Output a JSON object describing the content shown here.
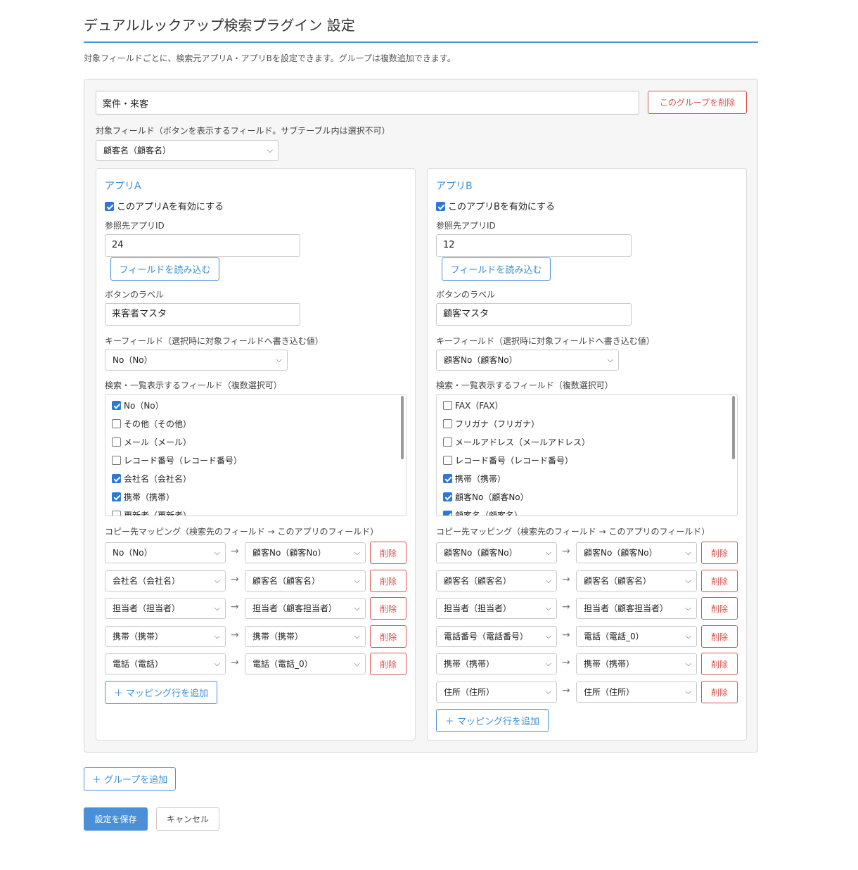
{
  "page": {
    "title": "デュアルルックアップ検索プラグイン 設定",
    "description": "対象フィールドごとに、検索元アプリA・アプリBを設定できます。グループは複数追加できます。"
  },
  "group": {
    "name": "案件・来客",
    "delete_label": "このグループを削除",
    "target_label": "対象フィールド（ボタンを表示するフィールド。サブテーブル内は選択不可）",
    "target_value": "顧客名（顧客名）"
  },
  "app_a": {
    "title": "アプリA",
    "enable_label": "このアプリAを有効にする",
    "enabled": true,
    "app_id_label": "参照先アプリID",
    "app_id": "24",
    "load_label": "フィールドを読み込む",
    "button_label_label": "ボタンのラベル",
    "button_label": "来客者マスタ",
    "key_field_label": "キーフィールド（選択時に対象フィールドへ書き込む値）",
    "key_field": "No（No）",
    "fields_label": "検索・一覧表示するフィールド（複数選択可）",
    "fields": [
      {
        "label": "No（No）",
        "checked": true
      },
      {
        "label": "その他（その他）",
        "checked": false
      },
      {
        "label": "メール（メール）",
        "checked": false
      },
      {
        "label": "レコード番号（レコード番号）",
        "checked": false
      },
      {
        "label": "会社名（会社名）",
        "checked": true
      },
      {
        "label": "携帯（携帯）",
        "checked": true
      },
      {
        "label": "更新者（更新者）",
        "checked": false
      }
    ],
    "mapping_label": "コピー先マッピング（検索先のフィールド → このアプリのフィールド）",
    "mappings": [
      {
        "from": "No（No）",
        "to": "顧客No（顧客No）",
        "delete": "削除"
      },
      {
        "from": "会社名（会社名）",
        "to": "顧客名（顧客名）",
        "delete": "削除"
      },
      {
        "from": "担当者（担当者）",
        "to": "担当者（顧客担当者）",
        "delete": "削除"
      },
      {
        "from": "携帯（携帯）",
        "to": "携帯（携帯）",
        "delete": "削除"
      },
      {
        "from": "電話（電話）",
        "to": "電話（電話_0）",
        "delete": "削除"
      }
    ],
    "add_mapping_label": "＋ マッピング行を追加"
  },
  "app_b": {
    "title": "アプリB",
    "enable_label": "このアプリBを有効にする",
    "enabled": true,
    "app_id_label": "参照先アプリID",
    "app_id": "12",
    "load_label": "フィールドを読み込む",
    "button_label_label": "ボタンのラベル",
    "button_label": "顧客マスタ",
    "key_field_label": "キーフィールド（選択時に対象フィールドへ書き込む値）",
    "key_field": "顧客No（顧客No）",
    "fields_label": "検索・一覧表示するフィールド（複数選択可）",
    "fields": [
      {
        "label": "FAX（FAX）",
        "checked": false
      },
      {
        "label": "フリガナ（フリガナ）",
        "checked": false
      },
      {
        "label": "メールアドレス（メールアドレス）",
        "checked": false
      },
      {
        "label": "レコード番号（レコード番号）",
        "checked": false
      },
      {
        "label": "携帯（携帯）",
        "checked": true
      },
      {
        "label": "顧客No（顧客No）",
        "checked": true
      },
      {
        "label": "顧客名（顧客名）",
        "checked": true
      }
    ],
    "mapping_label": "コピー先マッピング（検索先のフィールド → このアプリのフィールド）",
    "mappings": [
      {
        "from": "顧客No（顧客No）",
        "to": "顧客No（顧客No）",
        "delete": "削除"
      },
      {
        "from": "顧客名（顧客名）",
        "to": "顧客名（顧客名）",
        "delete": "削除"
      },
      {
        "from": "担当者（担当者）",
        "to": "担当者（顧客担当者）",
        "delete": "削除"
      },
      {
        "from": "電話番号（電話番号）",
        "to": "電話（電話_0）",
        "delete": "削除"
      },
      {
        "from": "携帯（携帯）",
        "to": "携帯（携帯）",
        "delete": "削除"
      },
      {
        "from": "住所（住所）",
        "to": "住所（住所）",
        "delete": "削除"
      }
    ],
    "add_mapping_label": "＋ マッピング行を追加"
  },
  "footer": {
    "add_group_label": "＋ グループを追加",
    "save_label": "設定を保存",
    "cancel_label": "キャンセル"
  },
  "colors": {
    "accent": "#4a90d9",
    "danger": "#d9534f",
    "title_blue": "#3b8fd4"
  }
}
